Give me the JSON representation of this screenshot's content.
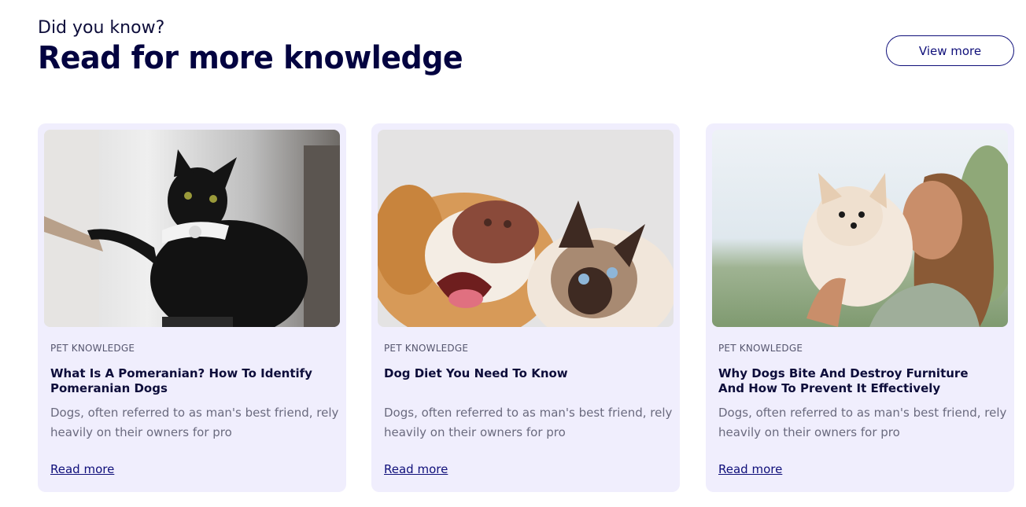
{
  "header": {
    "eyebrow": "Did you know?",
    "headline": "Read for more knowledge",
    "view_more_label": "View more"
  },
  "colors": {
    "accent": "#0f0f7a",
    "card_bg": "#f0eefd",
    "headline": "#030340"
  },
  "cards": [
    {
      "image_name": "black-cat-with-bow-tie-photo",
      "category": "PET KNOWLEDGE",
      "title": "What Is A Pomeranian? How To Identify Pomeranian Dogs",
      "excerpt": "Dogs, often referred to as man's best friend, rely heavily on their owners for pro",
      "read_more_label": "Read more"
    },
    {
      "image_name": "dog-and-siamese-cat-photo",
      "category": "PET KNOWLEDGE",
      "title": "Dog Diet You Need To Know",
      "excerpt": "Dogs, often referred to as man's best friend, rely heavily on their owners for pro",
      "read_more_label": "Read more"
    },
    {
      "image_name": "woman-kissing-pomeranian-photo",
      "category": "PET KNOWLEDGE",
      "title": "Why Dogs Bite And Destroy Furniture And How To Prevent It Effectively",
      "excerpt": "Dogs, often referred to as man's best friend, rely heavily on their owners for pro",
      "read_more_label": "Read more"
    }
  ]
}
